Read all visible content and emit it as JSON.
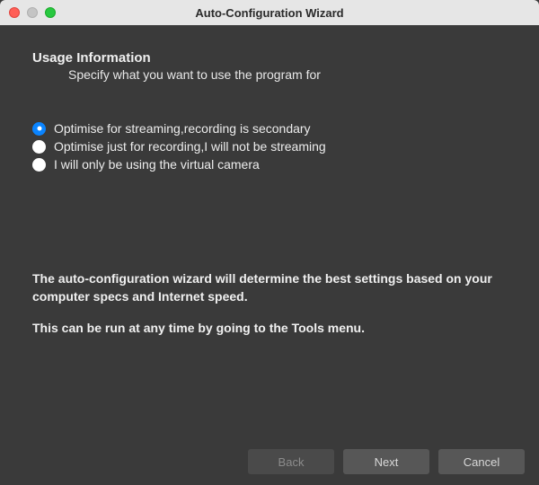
{
  "window": {
    "title": "Auto-Configuration Wizard"
  },
  "header": {
    "title": "Usage Information",
    "subtitle": "Specify what you want to use the program for"
  },
  "options": [
    {
      "label": "Optimise for streaming,recording is secondary",
      "selected": true
    },
    {
      "label": "Optimise just for recording,I will not be streaming",
      "selected": false
    },
    {
      "label": "I will only be using the virtual camera",
      "selected": false
    }
  ],
  "info": {
    "line1": "The auto-configuration wizard will determine the best settings based on your computer specs and Internet speed.",
    "line2": "This can be run at any time by going to the Tools menu."
  },
  "buttons": {
    "back": "Back",
    "next": "Next",
    "cancel": "Cancel"
  }
}
